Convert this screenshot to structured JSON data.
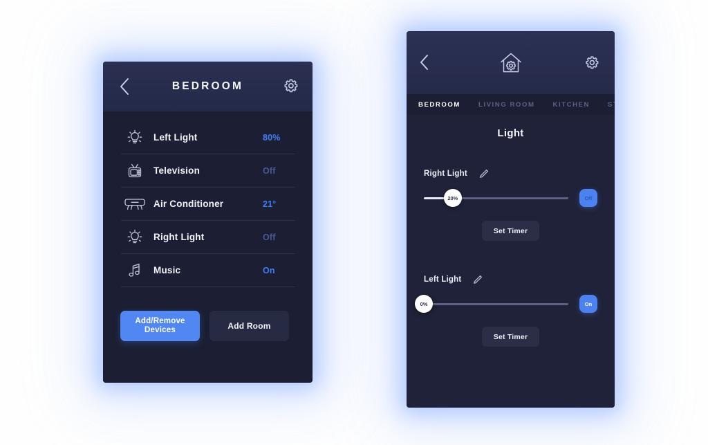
{
  "left_phone": {
    "header": {
      "title": "BEDROOM",
      "back_icon": "chevron-left-icon",
      "settings_icon": "gear-icon"
    },
    "devices": [
      {
        "icon": "light-bulb-icon",
        "label": "Left Light",
        "value": "80%",
        "state": "on"
      },
      {
        "icon": "television-icon",
        "label": "Television",
        "value": "Off",
        "state": "off"
      },
      {
        "icon": "air-conditioner-icon",
        "label": "Air Conditioner",
        "value": "21°",
        "state": "on"
      },
      {
        "icon": "light-bulb-icon",
        "label": "Right Light",
        "value": "Off",
        "state": "off"
      },
      {
        "icon": "music-note-icon",
        "label": "Music",
        "value": "On",
        "state": "on"
      }
    ],
    "actions": {
      "primary_label": "Add/Remove Devices",
      "secondary_label": "Add Room"
    }
  },
  "right_phone": {
    "header": {
      "back_icon": "chevron-left-icon",
      "home_icon": "home-gear-icon",
      "settings_icon": "gear-icon"
    },
    "tabs": [
      {
        "label": "BEDROOM",
        "active": true
      },
      {
        "label": "LIVING ROOM",
        "active": false
      },
      {
        "label": "KITCHEN",
        "active": false
      },
      {
        "label": "STU",
        "active": false
      }
    ],
    "section_title": "Light",
    "controls": [
      {
        "name": "Right Light",
        "edit_icon": "pencil-icon",
        "slider_value": "20%",
        "slider_percent": 20,
        "toggle_label": "Off",
        "toggle_state": "off",
        "timer_label": "Set Timer"
      },
      {
        "name": "Left Light",
        "edit_icon": "pencil-icon",
        "slider_value": "0%",
        "slider_percent": 0,
        "toggle_label": "On",
        "toggle_state": "on",
        "timer_label": "Set Timer"
      }
    ]
  },
  "colors": {
    "accent_blue": "#5087f2",
    "value_on": "#3d7ef5",
    "value_off": "#4a5894",
    "phone_bg": "#1c1f33",
    "header_bg": "#2b3052",
    "glow": "#b9cdff"
  }
}
